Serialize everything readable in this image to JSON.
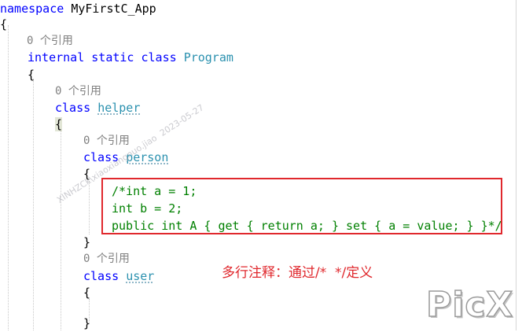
{
  "code": {
    "namespace_kw": "namespace",
    "namespace_name": "MyFirstC_App",
    "open_brace": "{",
    "close_brace": "}",
    "ref_lens": "0 个引用",
    "internal_kw": "internal",
    "static_kw": "static",
    "class_kw": "class",
    "program_name": "Program",
    "helper_name": "helper",
    "person_name": "person",
    "user_name": "user",
    "comment_line1": "/*int a = 1;",
    "comment_line2": "int b = 2;",
    "comment_line3": "public int A { get { return a; } set { a = value; } }*/"
  },
  "annotation": {
    "text": "多行注释：通过/*  */定义",
    "color": "#e0282d"
  },
  "watermarks": {
    "diagonal": "XINHZCk\\xiaoxiangnuo.jiao  2023-05-27",
    "logo": "PicX"
  },
  "colors": {
    "keyword": "#0000ff",
    "type_name": "#2b91af",
    "comment": "#008000",
    "lens": "#808080"
  }
}
